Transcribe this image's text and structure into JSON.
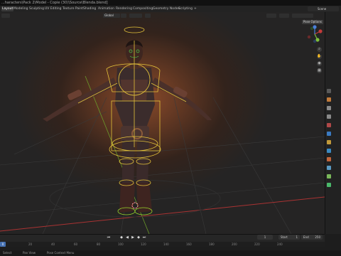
{
  "window": {
    "title": "...haracters\\Pack 2\\Model - Copie (30)\\Source\\Blenda.blend]"
  },
  "menu": {
    "tabs": [
      "Layout",
      "Modeling",
      "Sculpting",
      "UV Editing",
      "Texture Paint",
      "Shading",
      "Animation",
      "Rendering",
      "Compositing",
      "Geometry Nodes",
      "Scripting",
      "+"
    ],
    "active_tab": "Layout",
    "scene_label": "Scene"
  },
  "viewport": {
    "mode": "Global",
    "overlay_label": "Pose Options",
    "gizmo_axes": [
      "X",
      "Y",
      "Z"
    ]
  },
  "timeline": {
    "current_frame": "1",
    "start_label": "Start",
    "start_value": "1",
    "end_label": "End",
    "end_value": "250"
  },
  "ruler": {
    "current": "0",
    "ticks": [
      "20",
      "40",
      "60",
      "80",
      "100",
      "120",
      "140",
      "160",
      "180",
      "200",
      "220",
      "240"
    ]
  },
  "status": {
    "left_a": "Select",
    "left_b": "Pan View",
    "left_c": "Pose Context Menu"
  },
  "colors": {
    "accent": "#4772b3",
    "bone": "#e3c23a",
    "axis_x": "#c43a3a",
    "axis_y": "#7fbf3a",
    "axis_z": "#4a7fd8"
  }
}
